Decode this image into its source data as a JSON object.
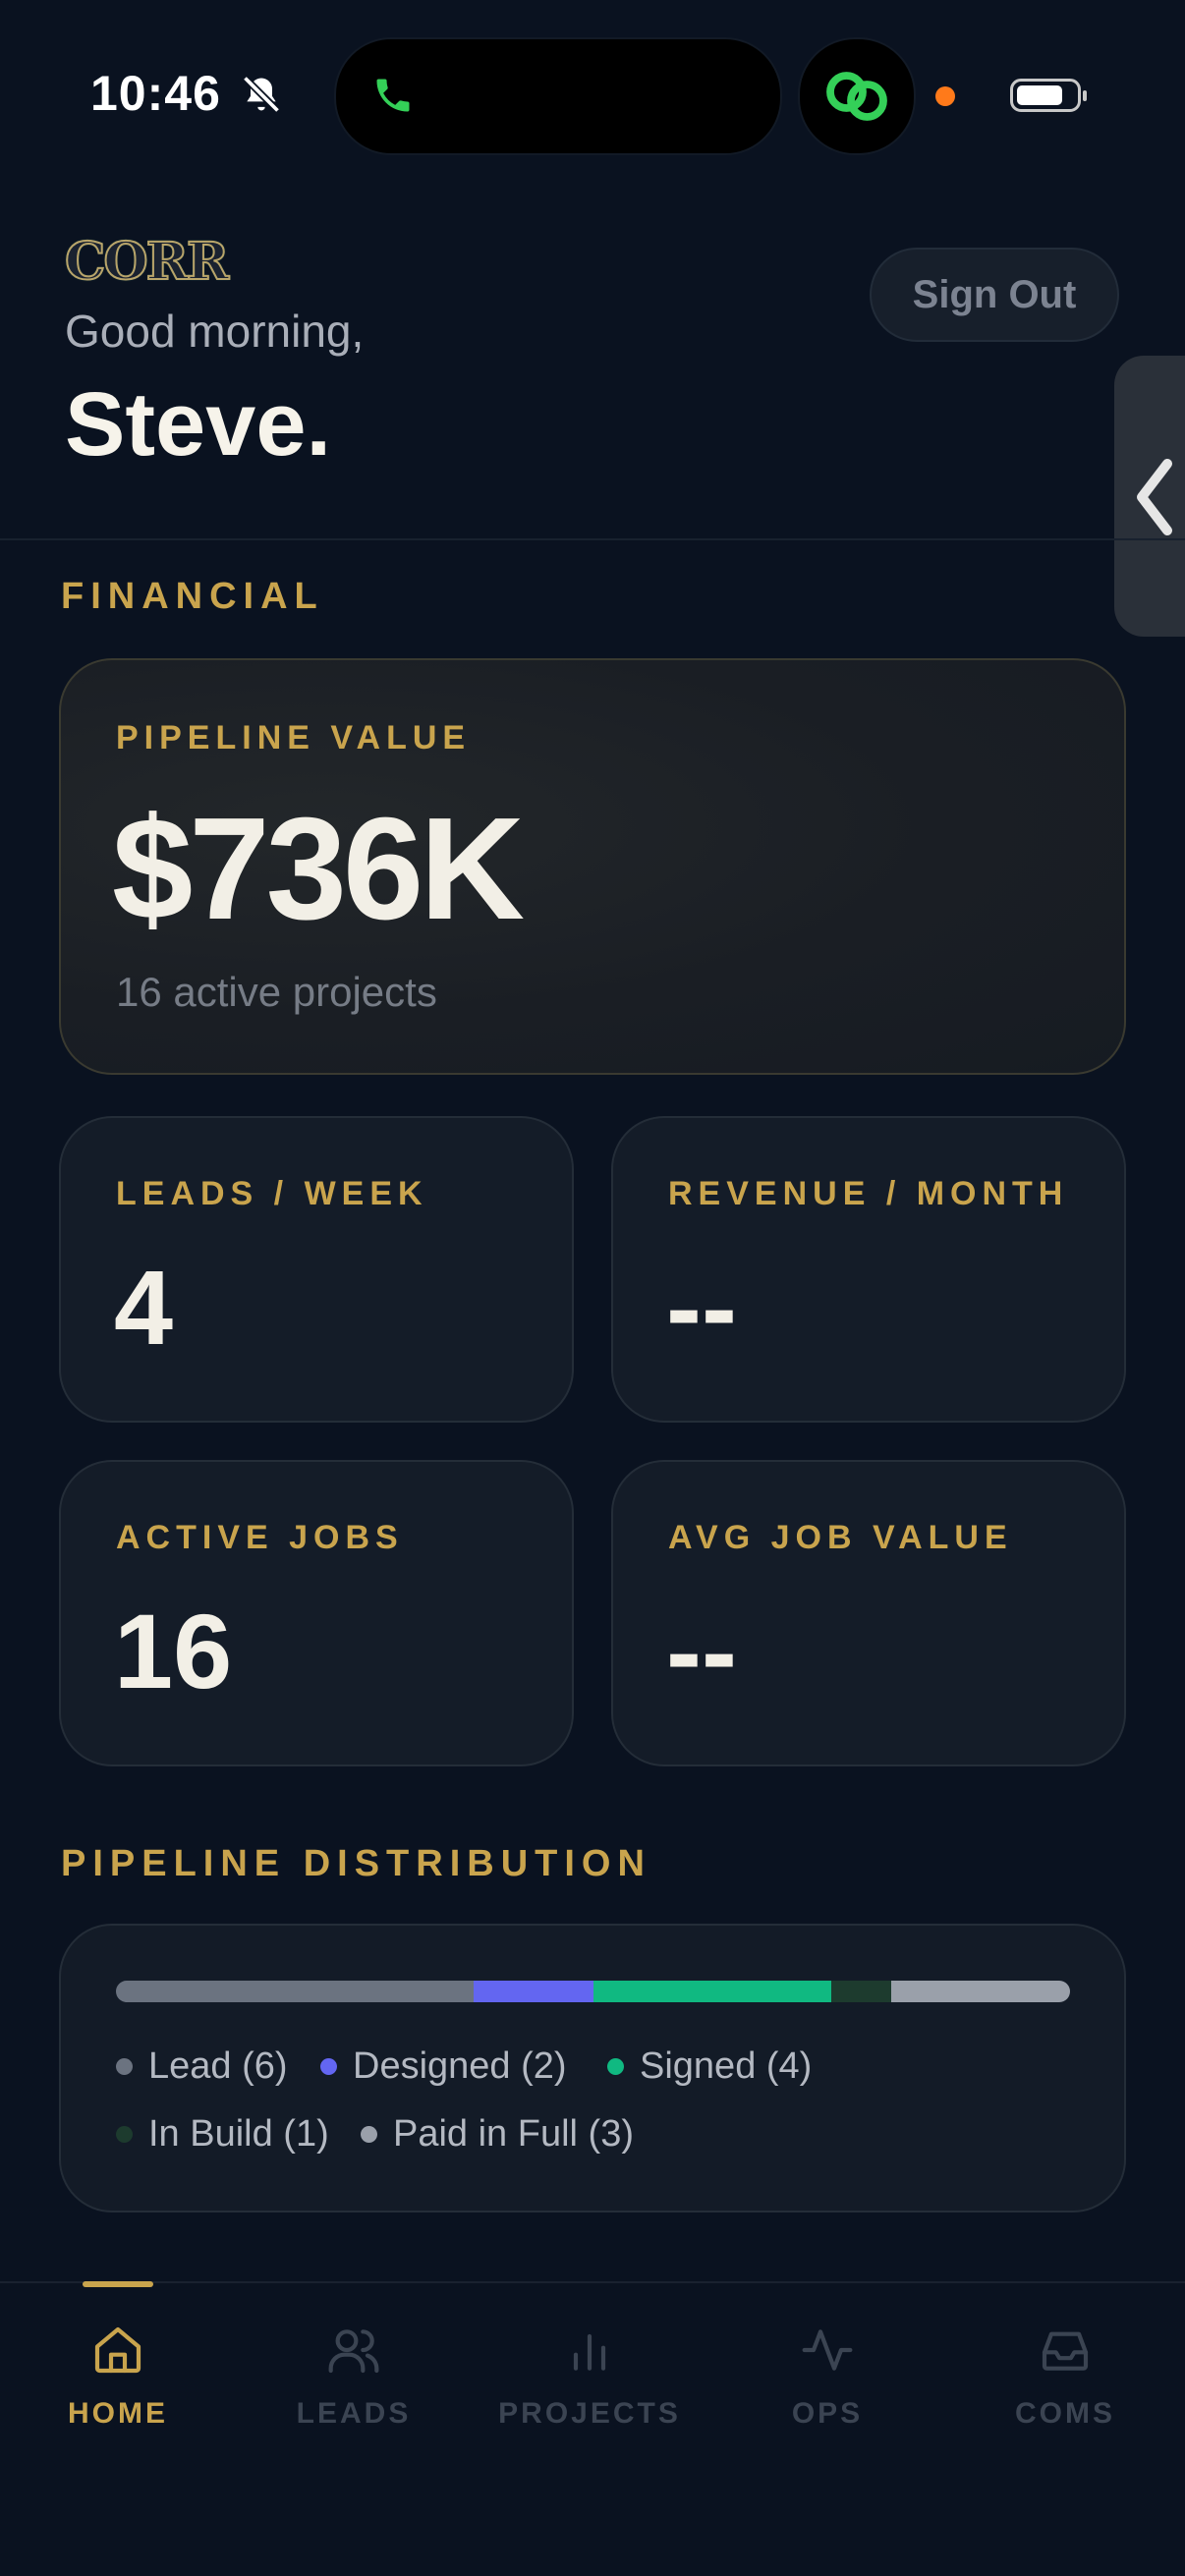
{
  "status_bar": {
    "time": "10:46"
  },
  "header": {
    "logo_text": "CORR",
    "greeting": "Good morning,",
    "user_name": "Steve.",
    "sign_out_label": "Sign Out"
  },
  "financial": {
    "section_title": "FINANCIAL",
    "pipeline": {
      "label": "PIPELINE VALUE",
      "value": "$736K",
      "subtitle": "16 active projects"
    },
    "stats": [
      {
        "label": "LEADS / WEEK",
        "value": "4"
      },
      {
        "label": "REVENUE / MONTH",
        "value": "--"
      },
      {
        "label": "ACTIVE JOBS",
        "value": "16"
      },
      {
        "label": "AVG JOB VALUE",
        "value": "--"
      }
    ]
  },
  "distribution": {
    "section_title": "PIPELINE DISTRIBUTION",
    "segments": [
      {
        "name": "Lead",
        "count": 6,
        "color": "#6b7380",
        "legend": "Lead (6)"
      },
      {
        "name": "Designed",
        "count": 2,
        "color": "#6366f1",
        "legend": "Designed (2)"
      },
      {
        "name": "Signed",
        "count": 4,
        "color": "#10b981",
        "legend": "Signed (4)"
      },
      {
        "name": "In Build",
        "count": 1,
        "color": "#1d3b2e",
        "legend": "In Build (1)"
      },
      {
        "name": "Paid in Full",
        "count": 3,
        "color": "#9aa0aa",
        "legend": "Paid in Full (3)"
      }
    ]
  },
  "nav": {
    "items": [
      {
        "label": "HOME",
        "icon": "home-icon",
        "active": true
      },
      {
        "label": "LEADS",
        "icon": "users-icon",
        "active": false
      },
      {
        "label": "PROJECTS",
        "icon": "bar-chart-icon",
        "active": false
      },
      {
        "label": "OPS",
        "icon": "activity-icon",
        "active": false
      },
      {
        "label": "COMS",
        "icon": "inbox-icon",
        "active": false
      }
    ]
  },
  "colors": {
    "accent": "#c9a44d",
    "background": "#0a1220",
    "card": "#141c28",
    "inactive": "#3b4452"
  }
}
